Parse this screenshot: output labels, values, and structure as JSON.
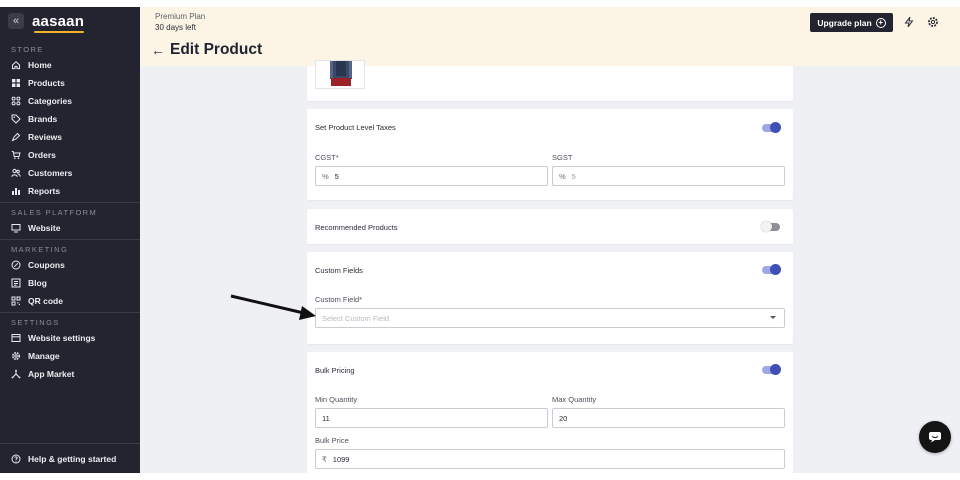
{
  "app": {
    "logo": "aasaan",
    "collapse_glyph": "«"
  },
  "sidebar": {
    "sections": {
      "store": "STORE",
      "sales_platform": "SALES PLATFORM",
      "marketing": "MARKETING",
      "settings": "SETTINGS"
    },
    "store_items": [
      {
        "label": "Home",
        "icon": "home-icon"
      },
      {
        "label": "Products",
        "icon": "products-grid-icon"
      },
      {
        "label": "Categories",
        "icon": "categories-icon"
      },
      {
        "label": "Brands",
        "icon": "tag-icon"
      },
      {
        "label": "Reviews",
        "icon": "reviews-icon"
      },
      {
        "label": "Orders",
        "icon": "cart-icon"
      },
      {
        "label": "Customers",
        "icon": "customers-icon"
      },
      {
        "label": "Reports",
        "icon": "bar-chart-icon"
      }
    ],
    "sales_items": [
      {
        "label": "Website",
        "icon": "monitor-icon"
      }
    ],
    "marketing_items": [
      {
        "label": "Coupons",
        "icon": "coupon-icon"
      },
      {
        "label": "Blog",
        "icon": "blog-icon"
      },
      {
        "label": "QR code",
        "icon": "qr-code-icon"
      }
    ],
    "settings_items": [
      {
        "label": "Website settings",
        "icon": "website-settings-icon"
      },
      {
        "label": "Manage",
        "icon": "gear-icon"
      },
      {
        "label": "App Market",
        "icon": "app-market-icon"
      }
    ],
    "help_label": "Help & getting started"
  },
  "topbar": {
    "plan_name": "Premium Plan",
    "plan_days": "30 days left",
    "upgrade_label": "Upgrade plan"
  },
  "page": {
    "title": "Edit Product"
  },
  "taxes": {
    "title": "Set Product Level Taxes",
    "enabled": true,
    "cgst_label": "CGST*",
    "cgst_prefix": "%",
    "cgst_value": "5",
    "sgst_label": "SGST",
    "sgst_prefix": "%",
    "sgst_value": "5"
  },
  "recommended": {
    "title": "Recommended Products",
    "enabled": false
  },
  "custom_fields": {
    "title": "Custom Fields",
    "enabled": true,
    "field_label": "Custom Field*",
    "placeholder": "Select Custom Field"
  },
  "bulk_pricing": {
    "title": "Bulk Pricing",
    "enabled": true,
    "min_label": "Min Quantity",
    "min_value": "11",
    "max_label": "Max Quantity",
    "max_value": "20",
    "price_label": "Bulk Price",
    "price_prefix": "₹",
    "price_value": "1099"
  },
  "colors": {
    "sidebar_bg": "#23242f",
    "topbar_bg": "#fcf5e6",
    "accent": "#3f51b5",
    "logo_underline": "#f4b328"
  }
}
